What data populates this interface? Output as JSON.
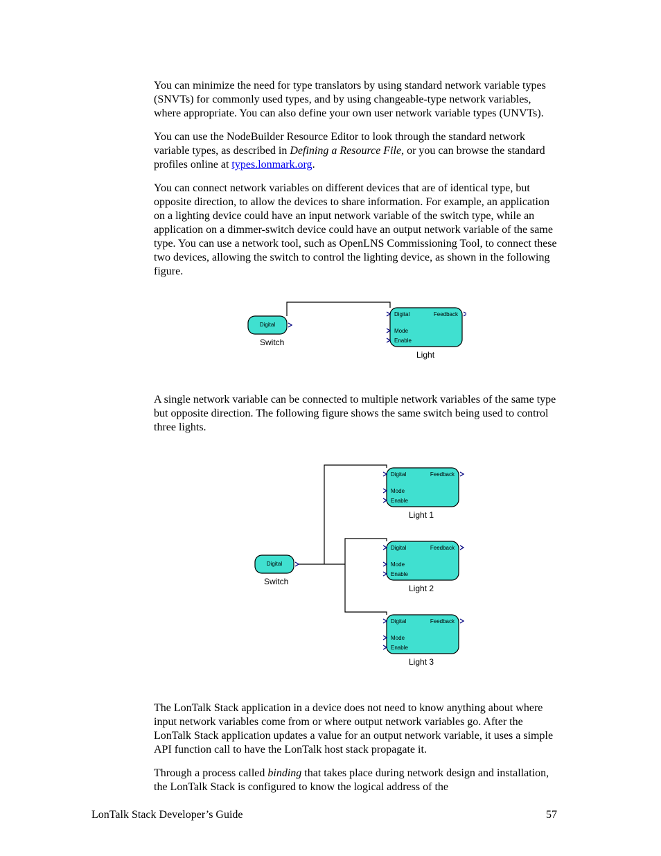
{
  "paragraphs": {
    "p1": "You can minimize the need for type translators by using standard network variable types (SNVTs) for commonly used types, and by using changeable-type network variables, where appropriate.  You can also define your own user network variable types (UNVTs).",
    "p2a": "You can use the NodeBuilder Resource Editor to look through the standard network variable types, as described in ",
    "p2_ital": "Defining a Resource File",
    "p2b": ", or you can browse the standard profiles online at ",
    "p2_link": "types.lonmark.org",
    "p2c": ".",
    "p3": "You can connect network variables on different devices that are of identical type, but opposite direction, to allow the devices to share information.  For example, an application on a lighting device could have an input network variable of the switch type, while an application on a dimmer-switch device could have an output network variable of the same type.  You can use a network tool, such as OpenLNS Commissioning Tool, to connect these two devices, allowing the switch to control the lighting device, as shown in the following figure.",
    "p4": "A single network variable can be connected to multiple network variables of the same type but opposite direction.  The following figure shows the same switch being used to control three lights.",
    "p5": "The LonTalk Stack application in a device does not need to know anything about where input network variables come from or where output network variables go.  After the LonTalk Stack application updates a value for an output network variable, it uses a simple API function call to have the LonTalk host stack propagate it.",
    "p6a": "Through a process called ",
    "p6_ital": "binding",
    "p6b": " that takes place during network design and installation, the LonTalk Stack is configured to know the logical address of the"
  },
  "diagram1": {
    "switch_caption": "Switch",
    "switch_pin": "Digital",
    "light_caption": "Light",
    "light_pins": {
      "digital": "Digital",
      "feedback": "Feedback",
      "mode": "Mode",
      "enable": "Enable"
    }
  },
  "diagram2": {
    "switch_caption": "Switch",
    "switch_pin": "Digital",
    "light_captions": [
      "Light 1",
      "Light 2",
      "Light 3"
    ],
    "light_pins": {
      "digital": "Digital",
      "feedback": "Feedback",
      "mode": "Mode",
      "enable": "Enable"
    }
  },
  "footer": {
    "title": "LonTalk Stack Developer’s Guide",
    "page": "57"
  }
}
